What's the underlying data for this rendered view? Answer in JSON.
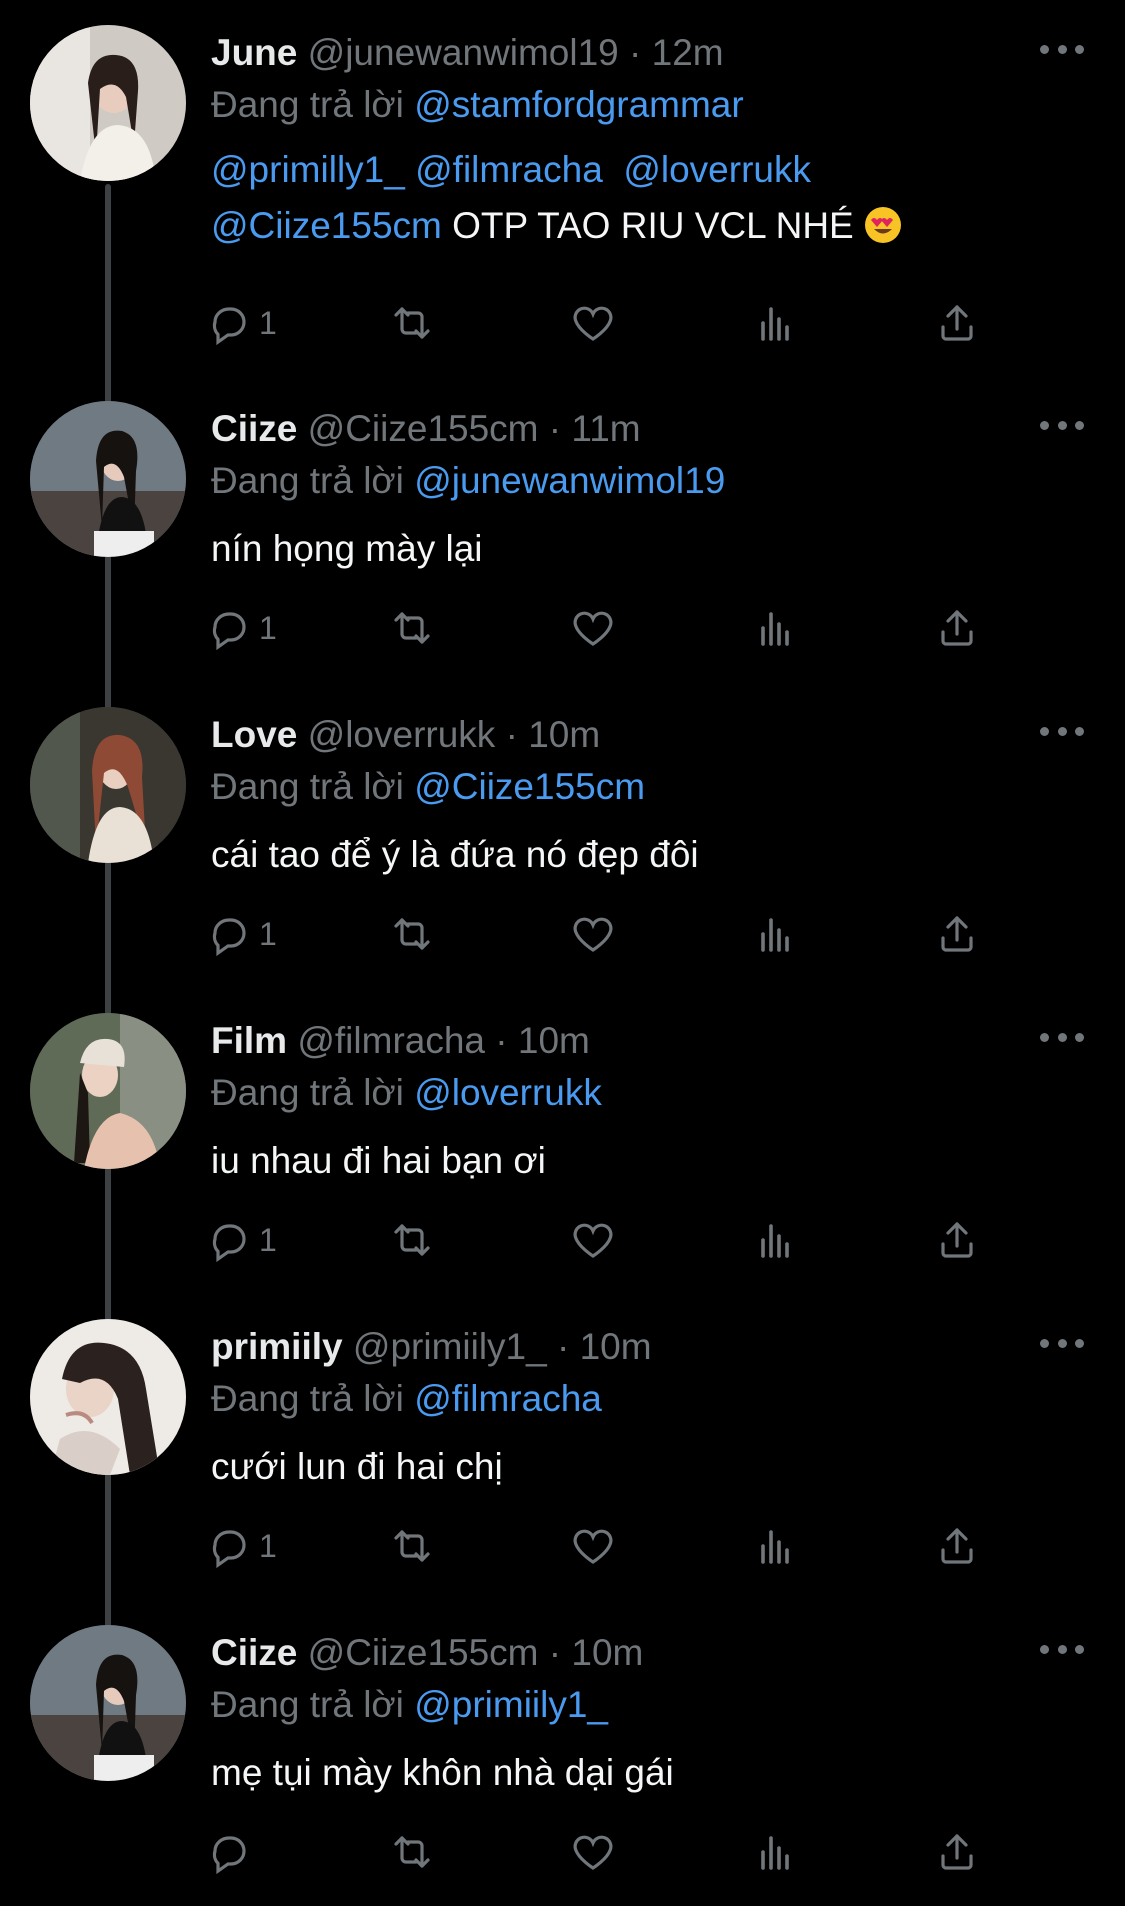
{
  "colors": {
    "background": "#000000",
    "text": "#e7e9ea",
    "muted": "#71767b",
    "mention": "#4a9bf0",
    "thread_line": "#3e4144"
  },
  "reply_prefix": "Đang trả lời",
  "tweets": [
    {
      "name": "June",
      "handle": "@junewanwimol19",
      "time": "12m",
      "replying_to": "@stamfordgrammar",
      "mentions_line": [
        "@primilly1_",
        "@filmracha",
        "@loverrukk"
      ],
      "line2_mention": "@Ciize155cm",
      "line2_text": " OTP TAO RIU VCL NHÉ ",
      "emoji": "heart-eyes-emoji",
      "reply_count": "1"
    },
    {
      "name": "Ciize",
      "handle": "@Ciize155cm",
      "time": "11m",
      "replying_to": "@junewanwimol19",
      "text": "nín họng mày lại",
      "reply_count": "1"
    },
    {
      "name": "Love",
      "handle": "@loverrukk",
      "time": "10m",
      "replying_to": "@Ciize155cm",
      "text": "cái tao để ý là đứa nó đẹp đôi",
      "reply_count": "1"
    },
    {
      "name": "Film",
      "handle": "@filmracha",
      "time": "10m",
      "replying_to": "@loverrukk",
      "text": "iu nhau đi hai bạn ơi",
      "reply_count": "1"
    },
    {
      "name": "primiily",
      "handle": "@primiily1_",
      "time": "10m",
      "replying_to": "@filmracha",
      "text": "cưới lun đi hai chị",
      "reply_count": "1"
    },
    {
      "name": "Ciize",
      "handle": "@Ciize155cm",
      "time": "10m",
      "replying_to": "@primiily1_",
      "text": "mẹ tụi mày khôn nhà dại gái",
      "reply_count": ""
    }
  ],
  "icons": {
    "reply": "reply-icon",
    "retweet": "retweet-icon",
    "like": "heart-icon",
    "views": "analytics-icon",
    "share": "share-icon",
    "more": "more-dots-icon"
  }
}
